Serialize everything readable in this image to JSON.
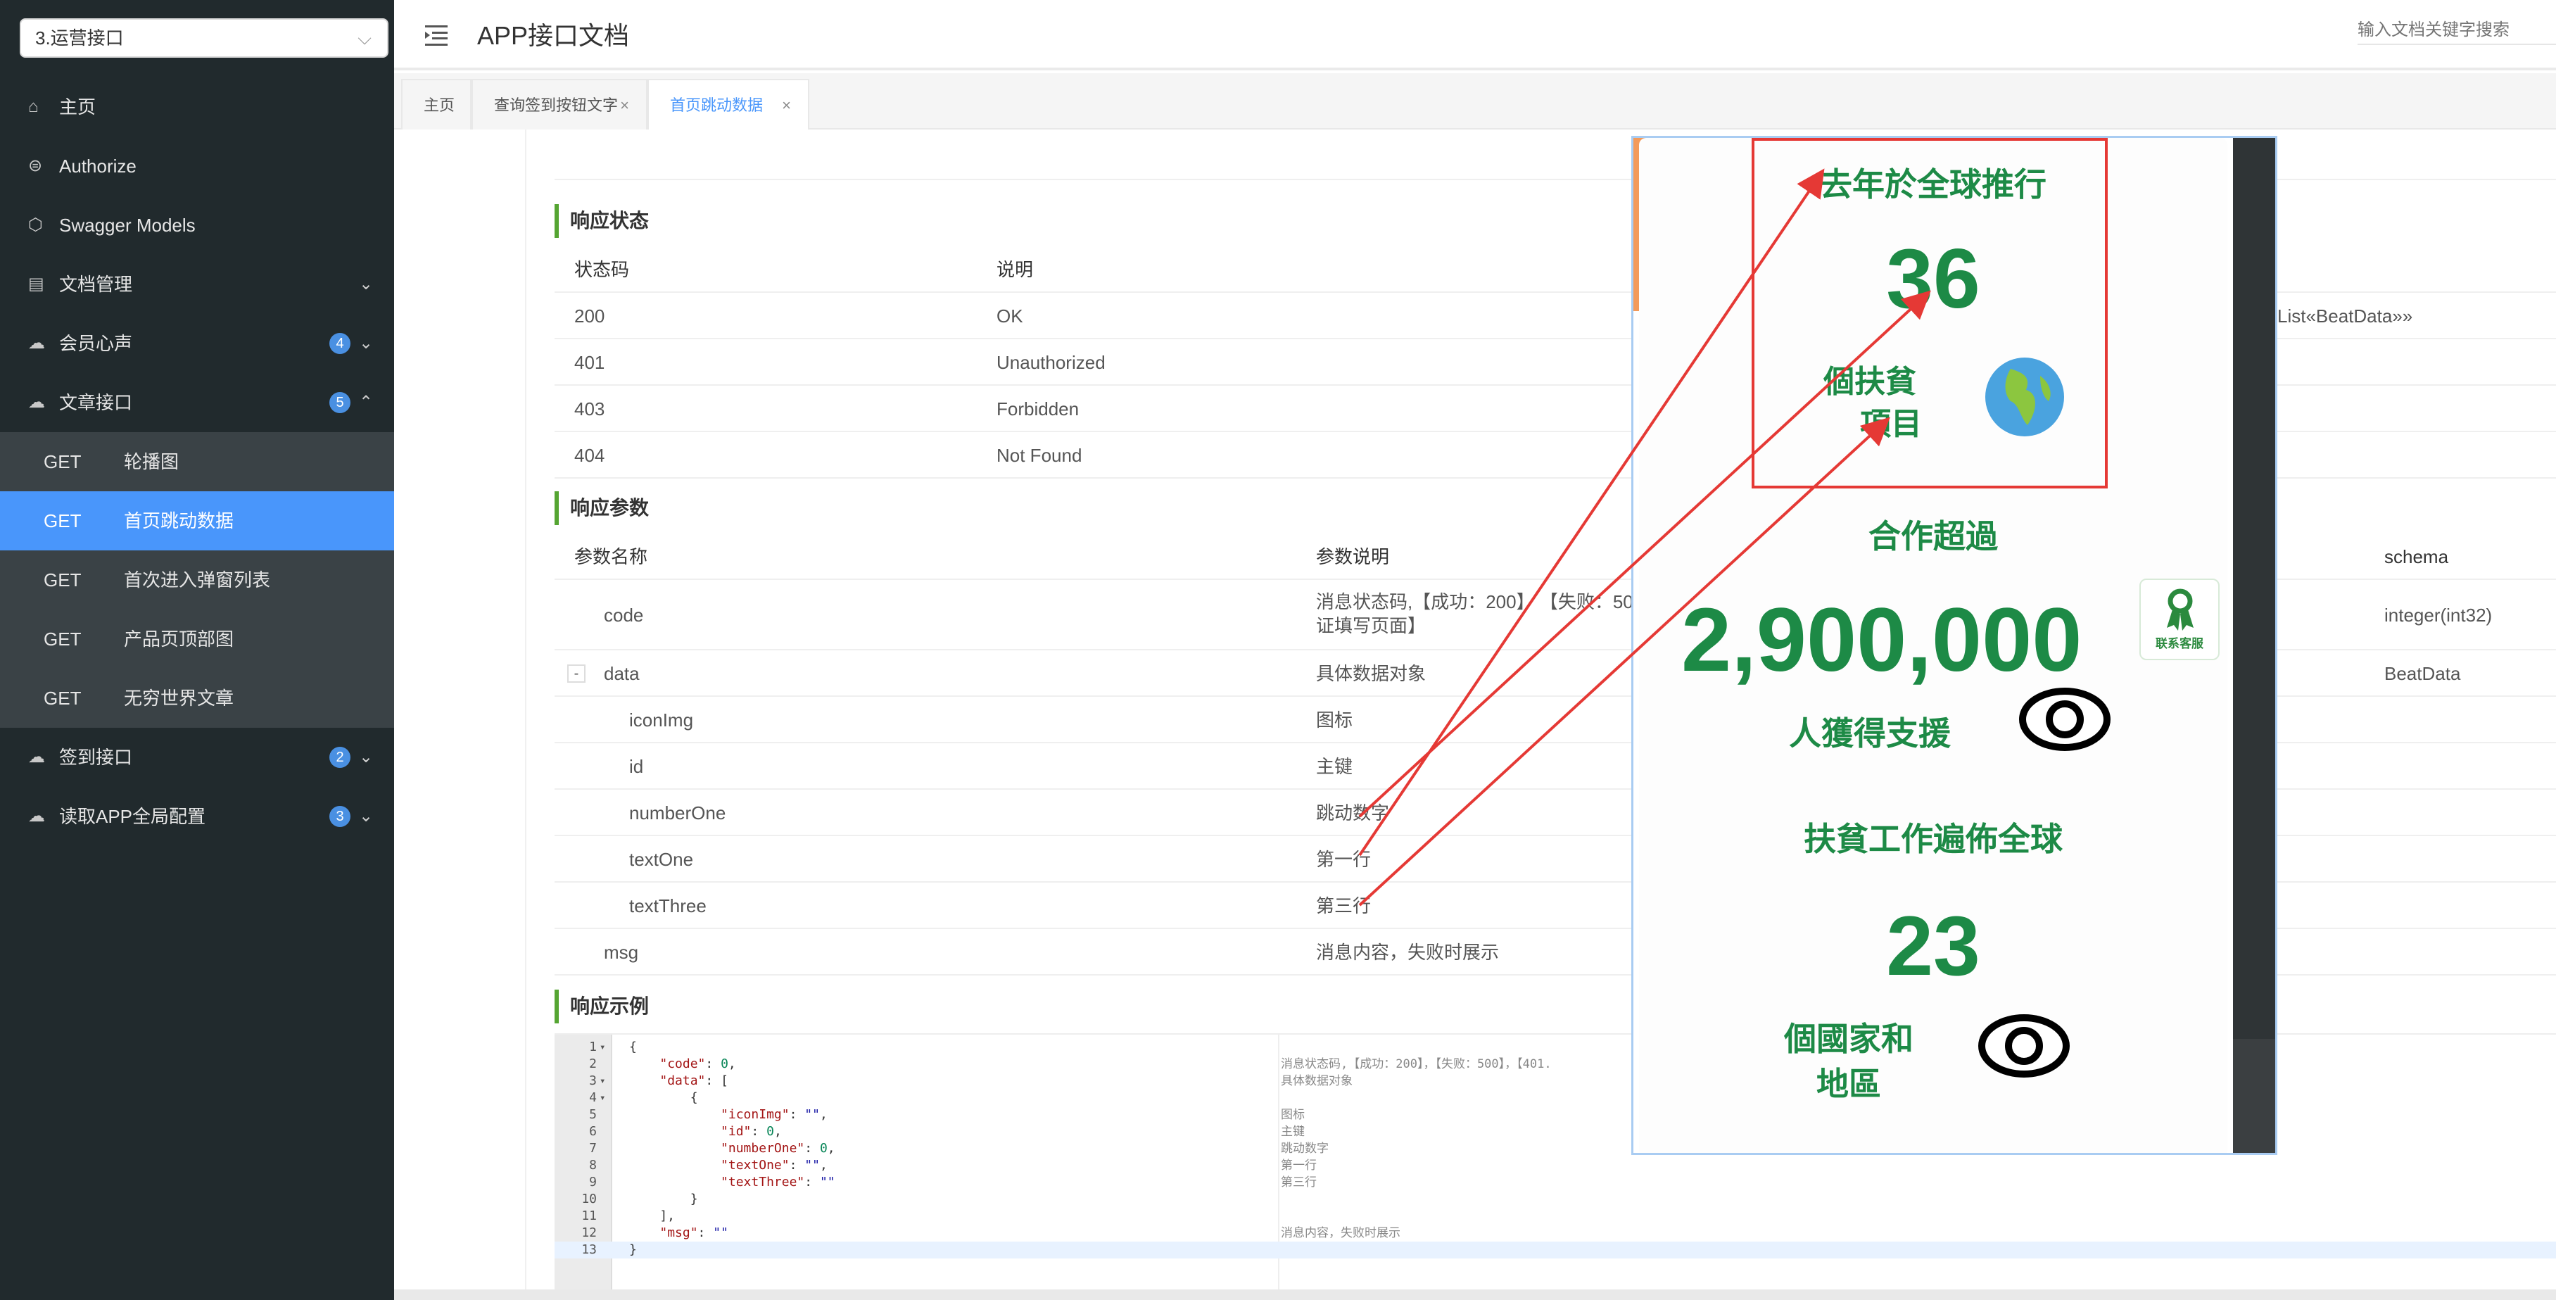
{
  "sidebar": {
    "project_select": "3.运营接口",
    "items": [
      {
        "label": "主页",
        "icon": "home-icon"
      },
      {
        "label": "Authorize",
        "icon": "lock-icon"
      },
      {
        "label": "Swagger Models",
        "icon": "cube-icon"
      },
      {
        "label": "文档管理",
        "icon": "doc-icon"
      },
      {
        "label": "会员心声",
        "icon": "cloud-icon",
        "badge": "4"
      },
      {
        "label": "文章接口",
        "icon": "cloud-icon",
        "badge": "5"
      },
      {
        "label": "签到接口",
        "icon": "cloud-icon",
        "badge": "2"
      },
      {
        "label": "读取APP全局配置",
        "icon": "cloud-icon",
        "badge": "3"
      }
    ],
    "sub_items": [
      {
        "method": "GET",
        "label": "轮播图"
      },
      {
        "method": "GET",
        "label": "首页跳动数据"
      },
      {
        "method": "GET",
        "label": "首次进入弹窗列表"
      },
      {
        "method": "GET",
        "label": "产品页顶部图"
      },
      {
        "method": "GET",
        "label": "无穷世界文章"
      }
    ]
  },
  "header": {
    "title": "APP接口文档",
    "search_placeholder": "输入文档关键字搜索"
  },
  "tabs": [
    {
      "label": "主页"
    },
    {
      "label": "查询签到按钮文字",
      "close": "×"
    },
    {
      "label": "首页跳动数据",
      "close": "×"
    }
  ],
  "response_status": {
    "title": "响应状态",
    "headers": [
      "状态码",
      "说明"
    ],
    "schema_fragment": "List«BeatData»»",
    "rows": [
      {
        "code": "200",
        "desc": "OK"
      },
      {
        "code": "401",
        "desc": "Unauthorized"
      },
      {
        "code": "403",
        "desc": "Forbidden"
      },
      {
        "code": "404",
        "desc": "Not Found"
      }
    ]
  },
  "response_params": {
    "title": "响应参数",
    "headers": [
      "参数名称",
      "参数说明",
      "schema"
    ],
    "toggle": "-",
    "rows": [
      {
        "name": "code",
        "desc": "消息状态码,【成功：200】 【失败：500",
        "desc2": "证填写页面】",
        "schema": "integer(int32)"
      },
      {
        "name": "data",
        "desc": "具体数据对象",
        "schema": "BeatData"
      },
      {
        "name": "iconImg",
        "desc": "图标",
        "schema": ""
      },
      {
        "name": "id",
        "desc": "主键",
        "schema": ""
      },
      {
        "name": "numberOne",
        "desc": "跳动数字",
        "schema": ""
      },
      {
        "name": "textOne",
        "desc": "第一行",
        "schema": ""
      },
      {
        "name": "textThree",
        "desc": "第三行",
        "schema": ""
      },
      {
        "name": "msg",
        "desc": "消息内容，失败时展示",
        "schema": ""
      }
    ]
  },
  "response_example": {
    "title": "响应示例",
    "lines": [
      {
        "no": "1",
        "fold": true,
        "code": "{",
        "comment": ""
      },
      {
        "no": "2",
        "code": "    \"code\": 0,",
        "comment": "消息状态码,【成功：200】，【失败：500】，【401."
      },
      {
        "no": "3",
        "fold": true,
        "code": "    \"data\": [",
        "comment": "具体数据对象"
      },
      {
        "no": "4",
        "fold": true,
        "code": "        {",
        "comment": ""
      },
      {
        "no": "5",
        "code": "            \"iconImg\": \"\",",
        "comment": "图标"
      },
      {
        "no": "6",
        "code": "            \"id\": 0,",
        "comment": "主键"
      },
      {
        "no": "7",
        "code": "            \"numberOne\": 0,",
        "comment": "跳动数字"
      },
      {
        "no": "8",
        "code": "            \"textOne\": \"\",",
        "comment": "第一行"
      },
      {
        "no": "9",
        "code": "            \"textThree\": \"\"",
        "comment": "第三行"
      },
      {
        "no": "10",
        "code": "        }",
        "comment": ""
      },
      {
        "no": "11",
        "code": "    ],",
        "comment": ""
      },
      {
        "no": "12",
        "code": "    \"msg\": \"\"",
        "comment": "消息内容，失败时展示"
      },
      {
        "no": "13",
        "code": "}",
        "comment": ""
      }
    ]
  },
  "overlay": {
    "heading1": "去年於全球推行",
    "number1": "36",
    "label1_line1": "個扶貧",
    "label1_line2": "項目",
    "heading2": "合作超過",
    "number2": "2,900,000",
    "label2": "人獲得支援",
    "heading3": "扶貧工作遍佈全球",
    "number3": "23",
    "label3_line1": "個國家和",
    "label3_line2": "地區",
    "chat_label": "联系客服"
  },
  "colors": {
    "sidebar_bg": "#212a2d",
    "active_item": "#4996fb",
    "accent_green": "#55a532",
    "overlay_green": "#1d8a46",
    "arrow_red": "#e53935"
  }
}
